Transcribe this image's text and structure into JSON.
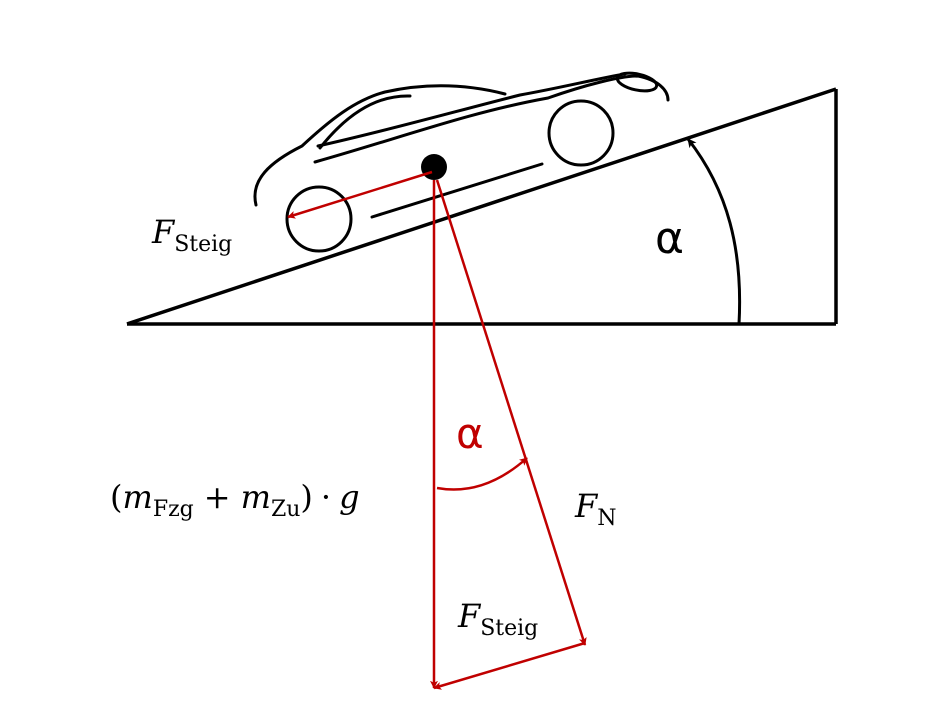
{
  "colors": {
    "ink": "#000000",
    "accent": "#c00000",
    "background": "#ffffff"
  },
  "labels": {
    "slope_angle": "α",
    "vector_angle": "α",
    "f_steig_top": {
      "main": "F",
      "sub": "Steig"
    },
    "f_steig_bottom": {
      "main": "F",
      "sub": "Steig"
    },
    "f_n": {
      "main": "F",
      "sub": "N"
    },
    "weight": {
      "open": "(",
      "m1": "m",
      "m1_sub": "Fzg",
      "plus": "+",
      "m2": "m",
      "m2_sub": "Zu",
      "close": ")",
      "dot": "·",
      "g": "g"
    }
  },
  "icons": [
    "car-icon"
  ]
}
